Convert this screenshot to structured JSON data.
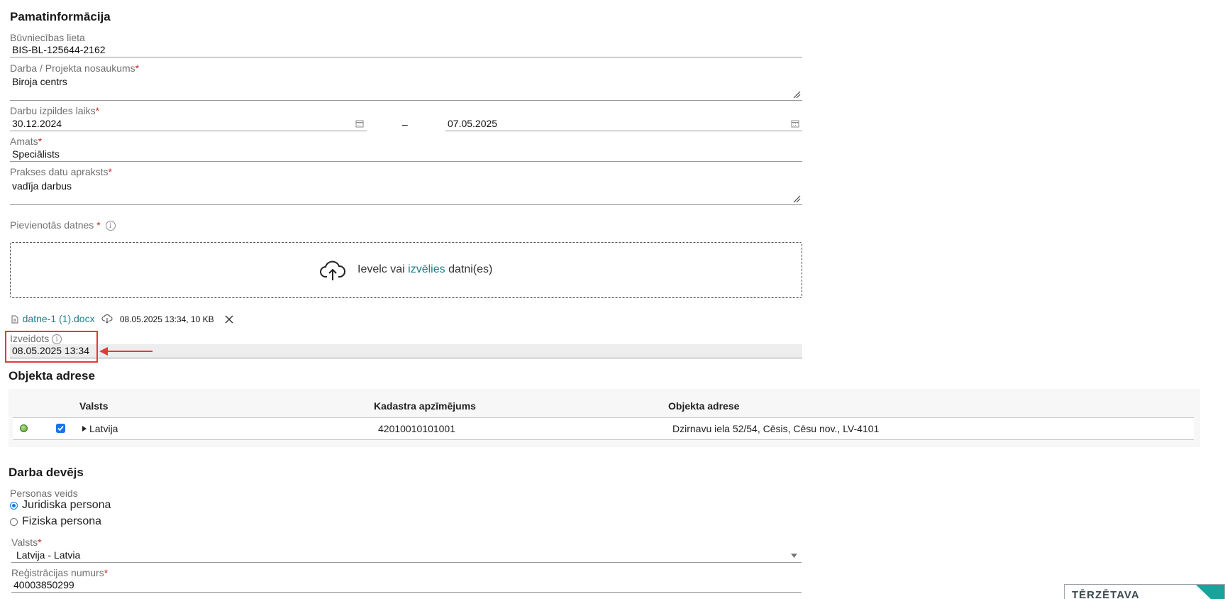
{
  "basic": {
    "title": "Pamatinformācija",
    "case_label": "Būvniecības lieta",
    "case_value": "BIS-BL-125644-2162",
    "project_label": "Darba / Projekta nosaukums",
    "project_value": "Biroja centrs",
    "period_label": "Darbu izpildes laiks",
    "date_from": "30.12.2024",
    "date_separator": "–",
    "date_to": "07.05.2025",
    "position_label": "Amats",
    "position_value": "Speciālists",
    "practice_label": "Prakses datu apraksts",
    "practice_value": "vadīja darbus",
    "required_mark": "*"
  },
  "files": {
    "label": "Pievienotās datnes",
    "info_glyph": "i",
    "drop_prefix": "Ievelc vai",
    "drop_link": "izvēlies",
    "drop_suffix": "datni(es)",
    "attached": {
      "name": "datne-1 (1).docx",
      "meta": "08.05.2025 13:34, 10 KB"
    },
    "created_label": "Izveidots",
    "created_value": "08.05.2025 13:34"
  },
  "address": {
    "title": "Objekta adrese",
    "headers": [
      "Valsts",
      "Kadastra apzīmējums",
      "Objekta adrese"
    ],
    "rows": [
      {
        "country": "Latvija",
        "cadastre": "42010010101001",
        "address": "Dzirnavu iela 52/54, Cēsis, Cēsu nov., LV-4101",
        "status_color": "#6ab04c",
        "checked": true
      }
    ]
  },
  "employer": {
    "title": "Darba devējs",
    "person_type_label": "Personas veids",
    "options": [
      "Juridiska persona",
      "Fiziska persona"
    ],
    "selected": "Juridiska persona",
    "country_label": "Valsts",
    "country_value": "Latvija - Latvia",
    "reg_label": "Reģistrācijas numurs",
    "reg_value": "40003850299"
  },
  "corner_badge": {
    "text": "TĒRZĒTAVA"
  },
  "colors": {
    "accent": "#1f7c8c",
    "required": "#c62828",
    "highlight": "#e53935",
    "teal": "#1aa39a"
  }
}
